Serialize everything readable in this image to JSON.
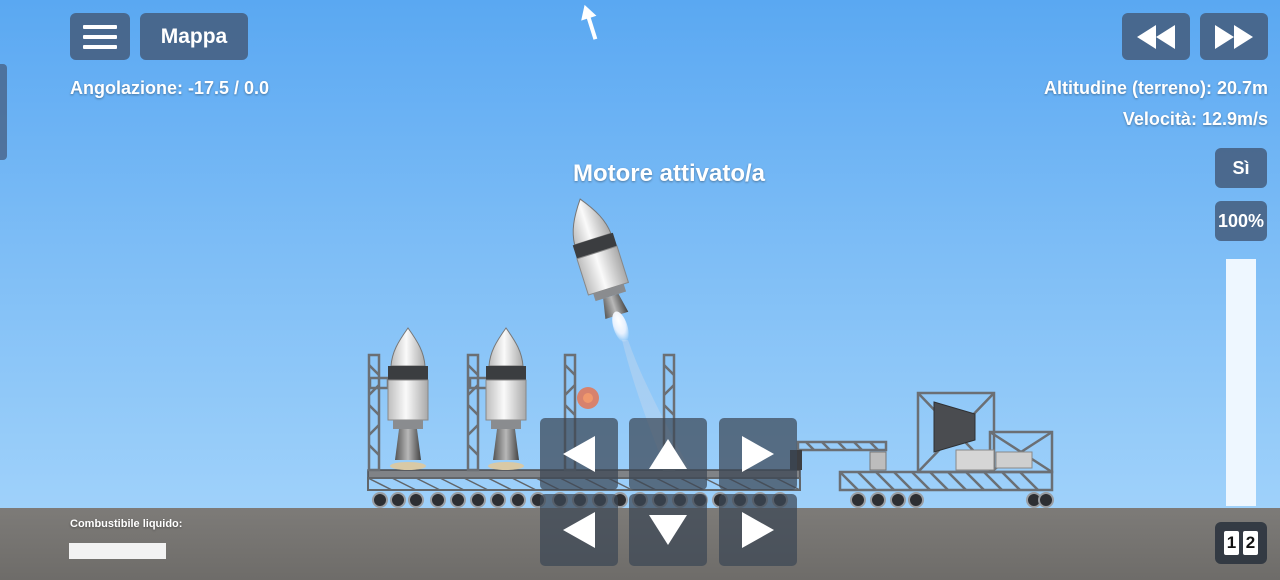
{
  "top_left": {
    "menu_icon": "hamburger-icon",
    "map_label": "Mappa"
  },
  "hud": {
    "pitch": "Angolazione: -17.5 / 0.0",
    "altitude": "Altitudine (terreno): 20.7m",
    "velocity": "Velocità: 12.9m/s",
    "message": "Motore attivato/a"
  },
  "time_controls": {
    "rewind_icon": "rewind-icon",
    "fast_forward_icon": "fast-forward-icon"
  },
  "right_panel": {
    "toggle_label": "Sì",
    "throttle_label": "100%",
    "throttle_level": 1.0,
    "stage_digits": [
      "1",
      "2"
    ]
  },
  "fuel": {
    "label": "Combustibile liquido:",
    "level": 1.0
  },
  "controls": {
    "upper_row": [
      "left-arrow-icon",
      "up-arrow-icon",
      "right-arrow-icon"
    ],
    "lower_row": [
      "left-arrow-icon",
      "down-arrow-icon",
      "right-arrow-icon"
    ]
  },
  "colors": {
    "button": "#465e80",
    "sky_top": "#5aa8f2",
    "ground": "#7d7b78",
    "text": "#ffffff"
  }
}
